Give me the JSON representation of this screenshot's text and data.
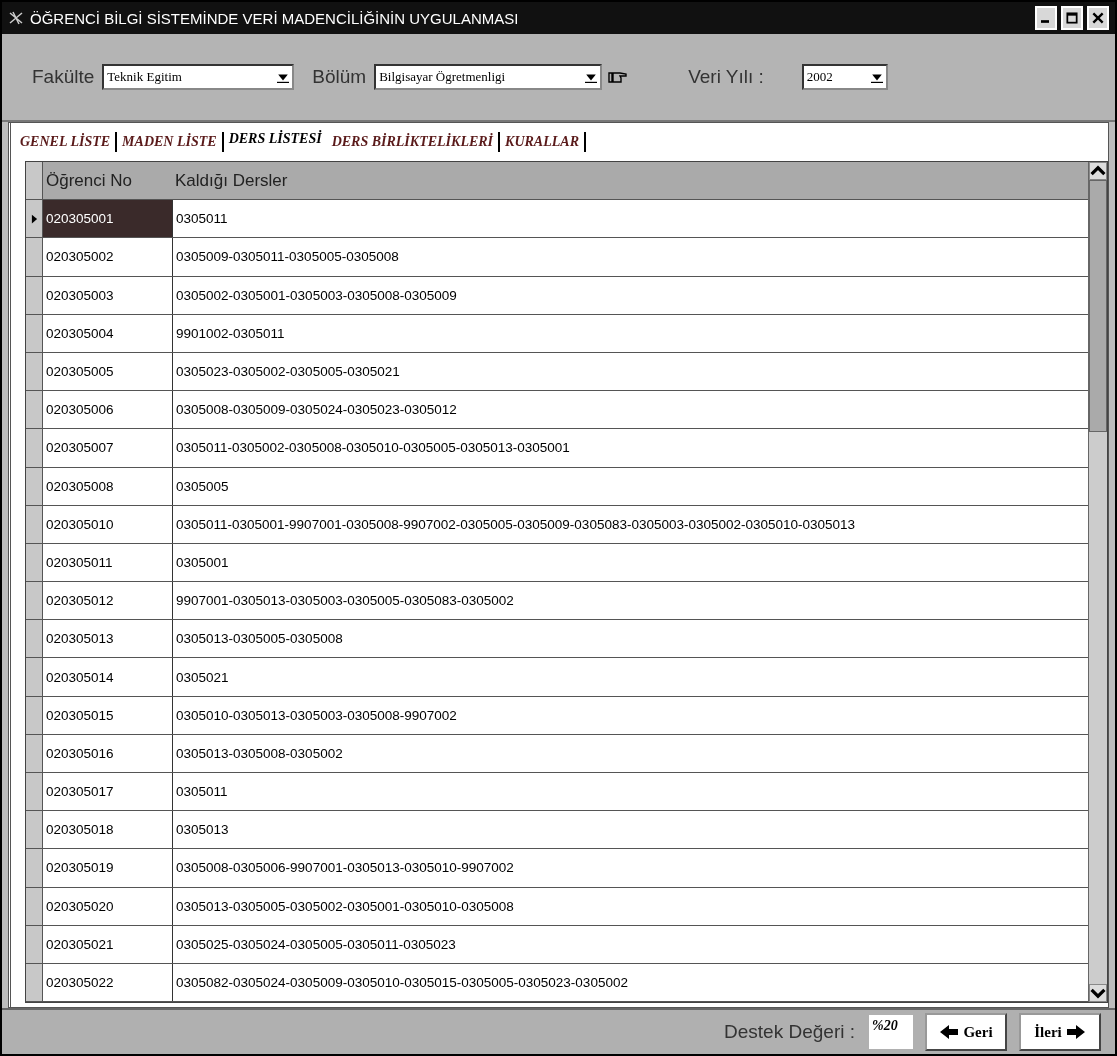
{
  "window": {
    "title": "ÖĞRENCİ BİLGİ SİSTEMİNDE VERİ MADENCİLİĞİNİN UYGULANMASI"
  },
  "filters": [
    {
      "label": "Fakülte",
      "value": "Teknik Egitim"
    },
    {
      "label": "Bölüm",
      "value": "Bilgisayar Ögretmenligi"
    },
    {
      "label": "Veri Yılı :",
      "value": "2002"
    }
  ],
  "tabs": [
    {
      "label": "GENEL LİSTE",
      "selected": false
    },
    {
      "label": "MADEN LİSTE",
      "selected": false
    },
    {
      "label": "DERS LİSTESİ",
      "selected": true
    },
    {
      "label": "DERS BİRLİKTELİKLERİ",
      "selected": false
    },
    {
      "label": "KURALLAR",
      "selected": false
    }
  ],
  "table": {
    "columns": [
      "Öğrenci No",
      "Kaldığı Dersler"
    ],
    "rows": [
      {
        "cells": [
          "020305001",
          "0305011"
        ],
        "selected": true
      },
      {
        "cells": [
          "020305002",
          "0305009-0305011-0305005-0305008"
        ],
        "selected": false
      },
      {
        "cells": [
          "020305003",
          "0305002-0305001-0305003-0305008-0305009"
        ],
        "selected": false
      },
      {
        "cells": [
          "020305004",
          "9901002-0305011"
        ],
        "selected": false
      },
      {
        "cells": [
          "020305005",
          "0305023-0305002-0305005-0305021"
        ],
        "selected": false
      },
      {
        "cells": [
          "020305006",
          "0305008-0305009-0305024-0305023-0305012"
        ],
        "selected": false
      },
      {
        "cells": [
          "020305007",
          "0305011-0305002-0305008-0305010-0305005-0305013-0305001"
        ],
        "selected": false
      },
      {
        "cells": [
          "020305008",
          "0305005"
        ],
        "selected": false
      },
      {
        "cells": [
          "020305010",
          "0305011-0305001-9907001-0305008-9907002-0305005-0305009-0305083-0305003-0305002-0305010-0305013"
        ],
        "selected": false
      },
      {
        "cells": [
          "020305011",
          "0305001"
        ],
        "selected": false
      },
      {
        "cells": [
          "020305012",
          "9907001-0305013-0305003-0305005-0305083-0305002"
        ],
        "selected": false
      },
      {
        "cells": [
          "020305013",
          "0305013-0305005-0305008"
        ],
        "selected": false
      },
      {
        "cells": [
          "020305014",
          "0305021"
        ],
        "selected": false
      },
      {
        "cells": [
          "020305015",
          "0305010-0305013-0305003-0305008-9907002"
        ],
        "selected": false
      },
      {
        "cells": [
          "020305016",
          "0305013-0305008-0305002"
        ],
        "selected": false
      },
      {
        "cells": [
          "020305017",
          "0305011"
        ],
        "selected": false
      },
      {
        "cells": [
          "020305018",
          "0305013"
        ],
        "selected": false
      },
      {
        "cells": [
          "020305019",
          "0305008-0305006-9907001-0305013-0305010-9907002"
        ],
        "selected": false
      },
      {
        "cells": [
          "020305020",
          "0305013-0305005-0305002-0305001-0305010-0305008"
        ],
        "selected": false
      },
      {
        "cells": [
          "020305021",
          "0305025-0305024-0305005-0305011-0305023"
        ],
        "selected": false
      },
      {
        "cells": [
          "020305022",
          "0305082-0305024-0305009-0305010-0305015-0305005-0305023-0305002"
        ],
        "selected": false
      }
    ]
  },
  "footer": {
    "label": "Destek Değeri :",
    "value": "%20",
    "buttons": [
      {
        "label": "Geri",
        "kind": "back"
      },
      {
        "label": "İleri",
        "kind": "forward"
      }
    ]
  }
}
